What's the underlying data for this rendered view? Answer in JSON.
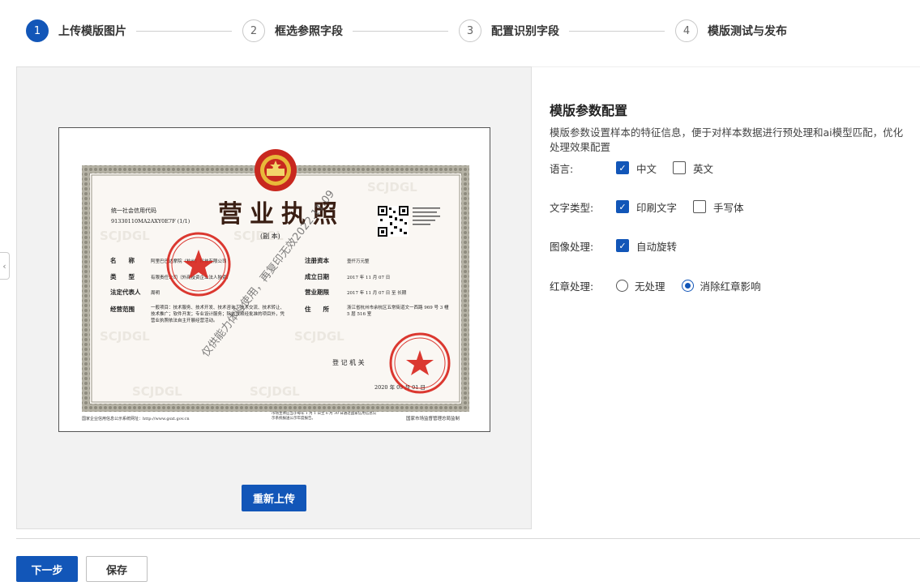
{
  "steps": [
    {
      "num": "1",
      "label": "上传模版图片",
      "active": true
    },
    {
      "num": "2",
      "label": "框选参照字段",
      "active": false
    },
    {
      "num": "3",
      "label": "配置识别字段",
      "active": false
    },
    {
      "num": "4",
      "label": "模版测试与发布",
      "active": false
    }
  ],
  "preview": {
    "reupload_label": "重新上传",
    "license": {
      "title": "营业执照",
      "subtitle": "(副 本)",
      "credit_code_label": "统一社会信用代码",
      "credit_code": "91330110MA2AXY0E7F (1/1)",
      "watermark": "仅供能力体验使用，再复印无效2022.11.09",
      "bg_watermark": "SCJDGL",
      "fields_left": [
        {
          "label": "名　　称",
          "value": "阿里巴巴达摩院（杭州）科技有限公司"
        },
        {
          "label": "类　　型",
          "value": "有限责任公司（外商投资企业法人独资）"
        },
        {
          "label": "法定代表人",
          "value": "周明"
        },
        {
          "label": "经营范围",
          "value": "一般项目：技术服务、技术开发、技术咨询、技术交流、技术转让、技术推广；软件开发；专业设计服务；除依法须经批准的项目外，凭营业执照依法自主开展经营活动。"
        }
      ],
      "fields_right": [
        {
          "label": "注册资本",
          "value": "壹仟万元整"
        },
        {
          "label": "成立日期",
          "value": "2017 年 11 月 07 日"
        },
        {
          "label": "营业期限",
          "value": "2017 年 11 月 07 日 至 长期"
        },
        {
          "label": "住　　所",
          "value": "浙江省杭州市余杭区五常街道文一西路 969 号 3 幢 5 层 516 室"
        }
      ],
      "registration_authority": "登 记 机 关",
      "date": "2020 年 09 月 01 日",
      "footer_left": "国家企业信用信息公示系统网址：http://www.gsxt.gov.cn",
      "footer_mid": "市场主体应当于每年 1 月 1 日至 6 月 30 日通过国家信用信息公示系统报送公示年度报告。",
      "footer_right": "国家市场监督管理总局监制"
    }
  },
  "config": {
    "title": "模版参数配置",
    "description": "模版参数设置样本的特征信息，便于对样本数据进行预处理和ai模型匹配，优化处理效果配置",
    "rows": [
      {
        "label": "语言:",
        "options": [
          {
            "label": "中文",
            "checked": true
          },
          {
            "label": "英文",
            "checked": false
          }
        ]
      },
      {
        "label": "文字类型:",
        "options": [
          {
            "label": "印刷文字",
            "checked": true
          },
          {
            "label": "手写体",
            "checked": false
          }
        ]
      },
      {
        "label": "图像处理:",
        "options": [
          {
            "label": "自动旋转",
            "checked": true
          }
        ]
      },
      {
        "label": "红章处理:",
        "options": [
          {
            "label": "无处理",
            "checked": false
          },
          {
            "label": "消除红章影响",
            "checked": true
          }
        ]
      }
    ]
  },
  "footer": {
    "next_label": "下一步",
    "save_label": "保存"
  },
  "colors": {
    "primary": "#1256b8",
    "seal_red": "#d8241c"
  }
}
